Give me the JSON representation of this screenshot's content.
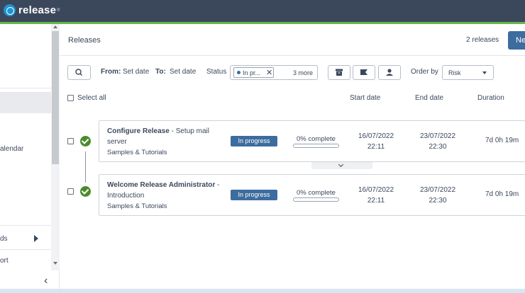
{
  "app": {
    "name": "release",
    "trademark": "®"
  },
  "sidebar": {
    "items": [
      {
        "label": "alendar"
      },
      {
        "label": "ds"
      },
      {
        "label": "ort"
      }
    ],
    "collapse_glyph": "‹"
  },
  "header": {
    "title": "Releases",
    "count": "2 releases",
    "new_label": "Ne"
  },
  "filters": {
    "from_label": "From:",
    "from_value": "Set date",
    "to_label": "To:",
    "to_value": "Set date",
    "status_label": "Status",
    "status_chip": "In pr...",
    "status_more": "3 more",
    "order_label": "Order by",
    "order_value": "Risk"
  },
  "columns": {
    "select_all": "Select all",
    "start": "Start date",
    "end": "End date",
    "duration": "Duration"
  },
  "releases": [
    {
      "title": "Configure Release",
      "subtitle_l1": " - Setup mail",
      "subtitle_l2": "server",
      "folder": "Samples & Tutorials",
      "status": "In progress",
      "progress_text": "0% complete",
      "progress": 0,
      "start_date": "16/07/2022",
      "start_time": "22:11",
      "end_date": "23/07/2022",
      "end_time": "22:30",
      "duration": "7d 0h 19m"
    },
    {
      "title": "Welcome Release Administrator",
      "subtitle_l1": " -",
      "subtitle_l2": "Introduction",
      "folder": "Samples & Tutorials",
      "status": "In progress",
      "progress_text": "0% complete",
      "progress": 0,
      "start_date": "16/07/2022",
      "start_time": "22:11",
      "end_date": "23/07/2022",
      "end_time": "22:30",
      "duration": "7d 0h 19m"
    }
  ],
  "colors": {
    "topbar": "#3b485c",
    "accent_green": "#68b749",
    "primary_blue": "#3d6c9e",
    "success_green": "#4a8c2a"
  },
  "icons": [
    "logo-icon",
    "search-icon",
    "archive-icon",
    "flag-icon",
    "user-icon",
    "close-icon",
    "caret-down-icon",
    "chevron-down-icon",
    "chevron-left-icon",
    "check-circle-icon"
  ]
}
